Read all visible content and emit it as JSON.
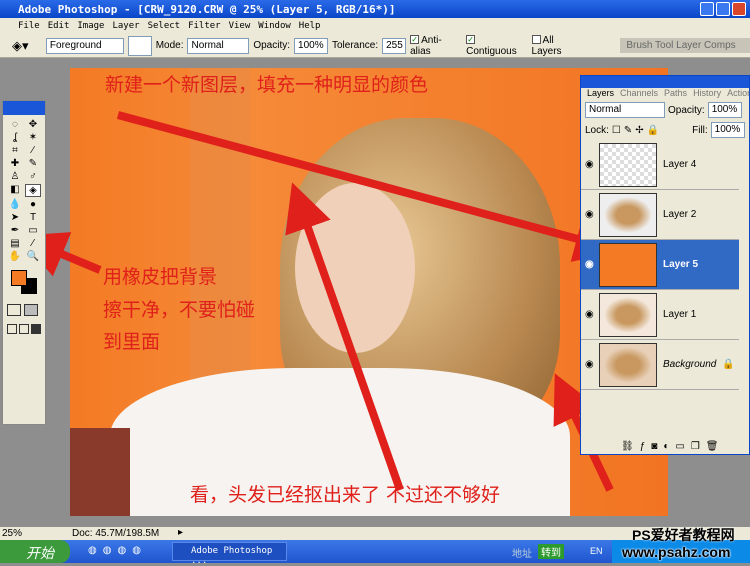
{
  "title": "Adobe Photoshop - [CRW_9120.CRW @ 25% (Layer 5, RGB/16*)]",
  "menu": [
    "File",
    "Edit",
    "Image",
    "Layer",
    "Select",
    "Filter",
    "View",
    "Window",
    "Help"
  ],
  "options": {
    "fill_source": "Foreground",
    "mode_label": "Mode:",
    "mode": "Normal",
    "opacity_label": "Opacity:",
    "opacity": "100%",
    "tolerance_label": "Tolerance:",
    "tolerance": "255",
    "antialias": "Anti-alias",
    "contiguous": "Contiguous",
    "all_layers": "All Layers",
    "well_tabs": "Brush Tool Layer Comps"
  },
  "layers_panel": {
    "tabs": [
      "Layers",
      "Channels",
      "Paths",
      "History",
      "Actions"
    ],
    "blend": "Normal",
    "opacity_label": "Opacity:",
    "opacity": "100%",
    "lock_label": "Lock:",
    "fill_label": "Fill:",
    "fill": "100%",
    "layers": [
      {
        "name": "Layer 4"
      },
      {
        "name": "Layer 2"
      },
      {
        "name": "Layer 5",
        "active": true
      },
      {
        "name": "Layer 1"
      },
      {
        "name": "Background",
        "locked": true
      }
    ]
  },
  "annotations": {
    "top": "新建一个新图层，填充一种明显的颜色",
    "left1": "用橡皮把背景",
    "left2": "擦干净，不要怕碰",
    "left3": "到里面",
    "bottom": "看，头发已经抠出来了 不过还不够好"
  },
  "colors": {
    "foreground": "#f47a24",
    "annotation": "#e0201a"
  },
  "status": {
    "zoom": "25%",
    "doc": "Doc: 45.7M/198.5M"
  },
  "taskbar": {
    "start": "开始",
    "app": "Adobe Photoshop ...",
    "address": "地址",
    "go": "转到",
    "lang": "EN"
  },
  "watermark": {
    "line1": "PS爱好者教程网",
    "line2": "www.psahz.com"
  }
}
